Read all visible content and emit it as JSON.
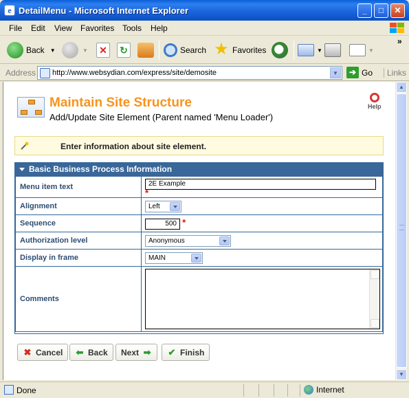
{
  "window": {
    "title": "DetailMenu - Microsoft Internet Explorer",
    "buttons": [
      "_",
      "□",
      "✕"
    ]
  },
  "menu": [
    "File",
    "Edit",
    "View",
    "Favorites",
    "Tools",
    "Help"
  ],
  "toolbar": {
    "back": "Back",
    "search": "Search",
    "favorites": "Favorites"
  },
  "address": {
    "label": "Address",
    "url": "http://www.websydian.com/express/site/demosite",
    "go": "Go",
    "links": "Links"
  },
  "page": {
    "title": "Maintain Site Structure",
    "subtitle": "Add/Update Site Element (Parent named 'Menu Loader')",
    "help": "Help",
    "info": "Enter information about site element.",
    "section_title": "Basic Business Process Information",
    "fields": {
      "menu_item_text": {
        "label": "Menu item text",
        "value": "2E Example"
      },
      "alignment": {
        "label": "Alignment",
        "value": "Left"
      },
      "sequence": {
        "label": "Sequence",
        "value": "500"
      },
      "authorization": {
        "label": "Authorization level",
        "value": "Anonymous"
      },
      "frame": {
        "label": "Display in frame",
        "value": "MAIN"
      },
      "comments": {
        "label": "Comments",
        "value": ""
      }
    },
    "required_mark": "*",
    "buttons": {
      "cancel": "Cancel",
      "back": "Back",
      "next": "Next",
      "finish": "Finish"
    }
  },
  "status": {
    "left": "Done",
    "zone": "Internet"
  },
  "colors": {
    "title_orange": "#f7941d",
    "section_blue": "#3a6799",
    "label_blue": "#2e4d72",
    "required_red": "#d11111"
  }
}
